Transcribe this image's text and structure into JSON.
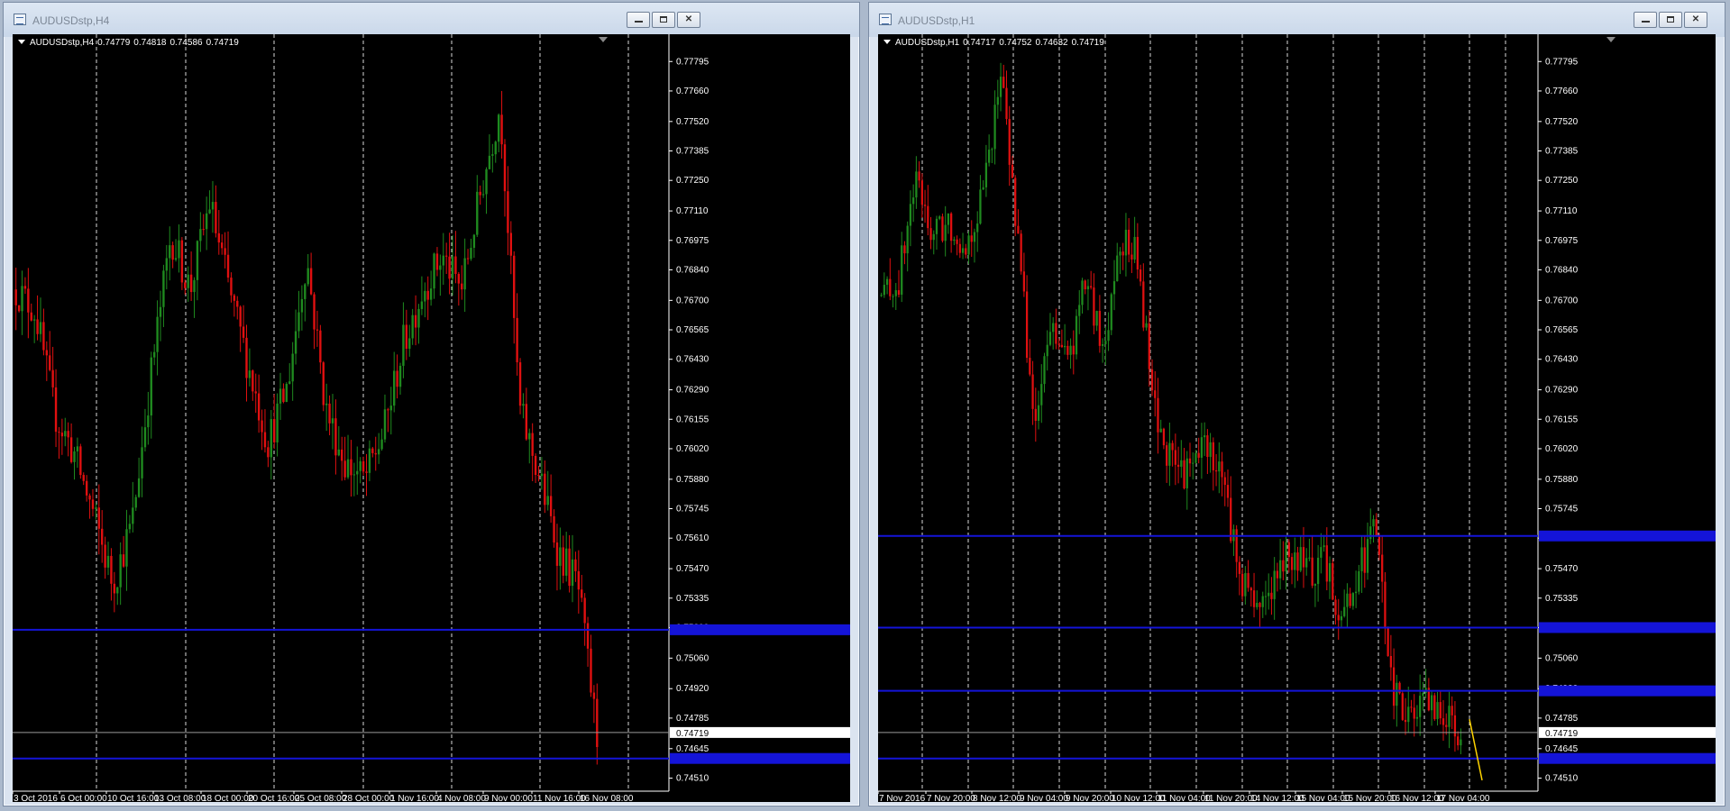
{
  "windows": [
    {
      "title": "AUDUSDstp,H4",
      "info": {
        "symbol": "AUDUSDstp,H4",
        "open": "0.74779",
        "high": "0.74818",
        "low": "0.74586",
        "close": "0.74719"
      },
      "colors": {
        "bull": "#1f8a1f",
        "bear": "#e01010",
        "level": "#1414d8",
        "grid": "#ffffff",
        "axis": "#ffffff"
      },
      "chart_data": {
        "type": "candlestick",
        "ylim": [
          0.7445,
          0.7792
        ],
        "price_labels": [
          "0.77795",
          "0.77660",
          "0.77520",
          "0.77385",
          "0.77250",
          "0.77110",
          "0.76975",
          "0.76840",
          "0.76700",
          "0.76565",
          "0.76430",
          "0.76290",
          "0.76155",
          "0.76020",
          "0.75880",
          "0.75745",
          "0.75610",
          "0.75470",
          "0.75335",
          "0.75200",
          "0.75060",
          "0.74920",
          "0.74785",
          "0.74645",
          "0.74510"
        ],
        "time_labels": [
          "3 Oct 2016",
          "6 Oct 00:00",
          "10 Oct 16:00",
          "13 Oct 08:00",
          "18 Oct 00:00",
          "20 Oct 16:00",
          "25 Oct 08:00",
          "28 Oct 00:00",
          "1 Nov 16:00",
          "4 Nov 08:00",
          "9 Nov 00:00",
          "11 Nov 16:00",
          "16 Nov 08:00"
        ],
        "current_price": "0.74719",
        "horizontal_levels": [
          0.7519,
          0.746
        ],
        "key_closes": [
          0.7675,
          0.7665,
          0.7618,
          0.76,
          0.7572,
          0.754,
          0.7568,
          0.7638,
          0.77,
          0.7675,
          0.7715,
          0.7675,
          0.764,
          0.7605,
          0.763,
          0.769,
          0.762,
          0.7595,
          0.7588,
          0.761,
          0.765,
          0.7675,
          0.769,
          0.7675,
          0.772,
          0.776,
          0.762,
          0.759,
          0.7555,
          0.754,
          0.747
        ]
      }
    },
    {
      "title": "AUDUSDstp,H1",
      "info": {
        "symbol": "AUDUSDstp,H1",
        "open": "0.74717",
        "high": "0.74752",
        "low": "0.74632",
        "close": "0.74719"
      },
      "colors": {
        "bull": "#1f8a1f",
        "bear": "#e01010",
        "level": "#1414d8",
        "grid": "#ffffff",
        "axis": "#ffffff",
        "trendline": "#ffd400"
      },
      "chart_data": {
        "type": "candlestick",
        "ylim": [
          0.7445,
          0.7792
        ],
        "price_labels": [
          "0.77795",
          "0.77660",
          "0.77520",
          "0.77385",
          "0.77250",
          "0.77110",
          "0.76975",
          "0.76840",
          "0.76700",
          "0.76565",
          "0.76430",
          "0.76290",
          "0.76155",
          "0.76020",
          "0.75880",
          "0.75745",
          "0.75610",
          "0.75470",
          "0.75335",
          "0.75200",
          "0.75060",
          "0.74920",
          "0.74785",
          "0.74645",
          "0.74510"
        ],
        "time_labels": [
          "7 Nov 2016",
          "7 Nov 20:00",
          "8 Nov 12:00",
          "9 Nov 04:00",
          "9 Nov 20:00",
          "10 Nov 12:00",
          "11 Nov 04:00",
          "11 Nov 20:00",
          "14 Nov 12:00",
          "15 Nov 04:00",
          "15 Nov 20:00",
          "16 Nov 12:00",
          "17 Nov 04:00"
        ],
        "current_price": "0.74719",
        "horizontal_levels": [
          0.7562,
          0.752,
          0.7491,
          0.746
        ],
        "key_closes": [
          0.7672,
          0.7678,
          0.7725,
          0.77,
          0.7705,
          0.7695,
          0.772,
          0.7775,
          0.77,
          0.761,
          0.766,
          0.764,
          0.768,
          0.7645,
          0.77,
          0.769,
          0.762,
          0.7595,
          0.759,
          0.7605,
          0.759,
          0.7545,
          0.753,
          0.754,
          0.7555,
          0.7545,
          0.755,
          0.7525,
          0.7545,
          0.7565,
          0.749,
          0.748,
          0.7485,
          0.748,
          0.7472
        ]
      }
    }
  ]
}
